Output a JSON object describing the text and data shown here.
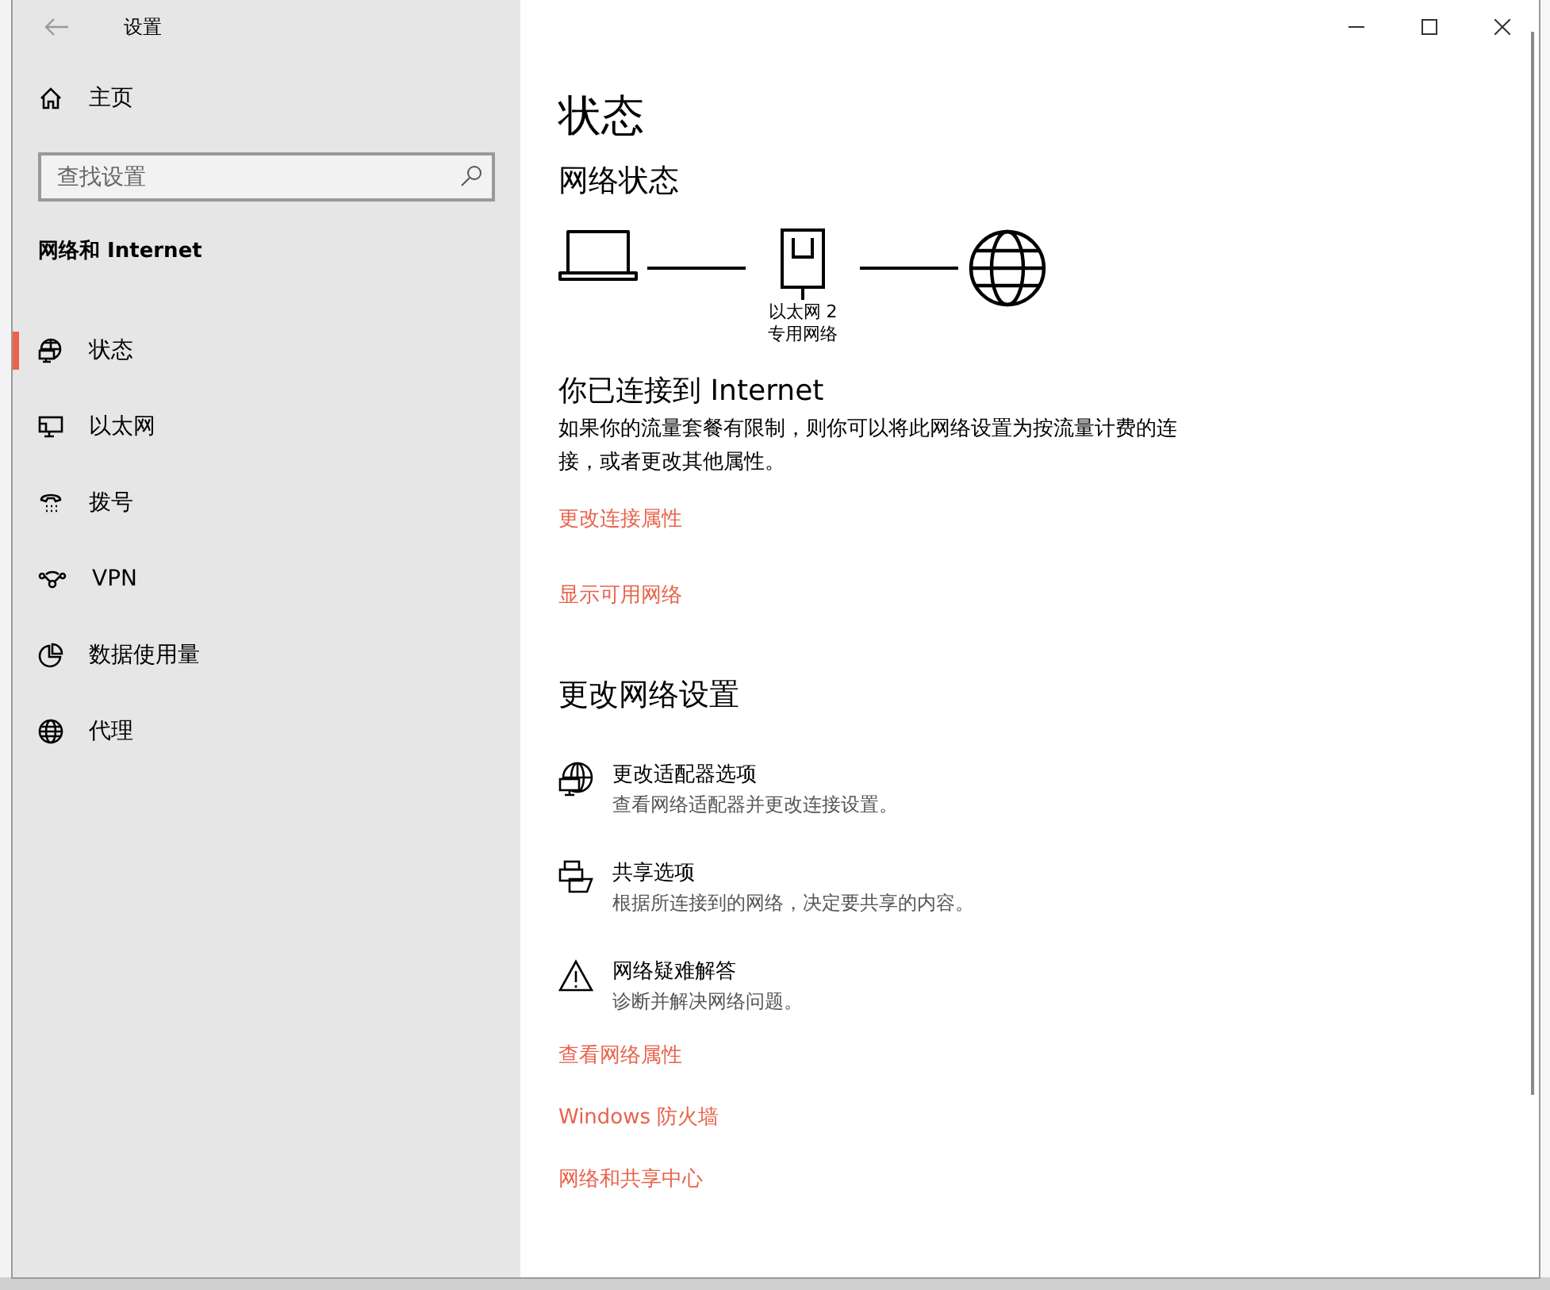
{
  "window": {
    "title": "设置"
  },
  "sidebar": {
    "home": "主页",
    "search": {
      "placeholder": "查找设置"
    },
    "section": "网络和 Internet",
    "items": [
      {
        "label": "状态",
        "selected": true
      },
      {
        "label": "以太网",
        "selected": false
      },
      {
        "label": "拨号",
        "selected": false
      },
      {
        "label": "VPN",
        "selected": false
      },
      {
        "label": "数据使用量",
        "selected": false
      },
      {
        "label": "代理",
        "selected": false
      }
    ]
  },
  "content": {
    "title": "状态",
    "network_status": {
      "heading": "网络状态",
      "adapter": "以太网 2",
      "profile": "专用网络"
    },
    "connection": {
      "heading": "你已连接到 Internet",
      "text": "如果你的流量套餐有限制，则你可以将此网络设置为按流量计费的连接，或者更改其他属性。",
      "links": [
        "更改连接属性",
        "显示可用网络"
      ]
    },
    "change_settings": {
      "heading": "更改网络设置",
      "options": [
        {
          "title": "更改适配器选项",
          "description": "查看网络适配器并更改连接设置。"
        },
        {
          "title": "共享选项",
          "description": "根据所连接到的网络，决定要共享的内容。"
        },
        {
          "title": "网络疑难解答",
          "description": "诊断并解决网络问题。"
        }
      ],
      "links": [
        "查看网络属性",
        "Windows 防火墙",
        "网络和共享中心"
      ]
    }
  }
}
